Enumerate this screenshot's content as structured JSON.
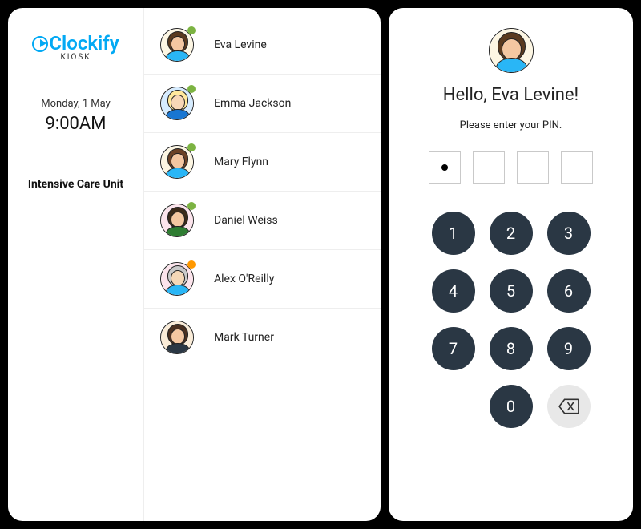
{
  "app": {
    "name": "Clockify",
    "subtitle": "KIOSK"
  },
  "sidebar": {
    "date": "Monday, 1 May",
    "time": "9:00AM",
    "unit": "Intensive Care Unit"
  },
  "employees": [
    {
      "name": "Eva Levine",
      "status": "green",
      "avatar": {
        "bg": "bg-cream",
        "hair": "#5b3a1e",
        "skin": "#f4c7a1",
        "shirt": "#29b6f6"
      }
    },
    {
      "name": "Emma Jackson",
      "status": "green",
      "avatar": {
        "bg": "bg-blue",
        "hair": "#ffe89c",
        "skin": "#f7d7b7",
        "shirt": "#1976d2"
      }
    },
    {
      "name": "Mary Flynn",
      "status": "green",
      "avatar": {
        "bg": "bg-cream",
        "hair": "#6b4226",
        "skin": "#f4c7a1",
        "shirt": "#29b6f6"
      }
    },
    {
      "name": "Daniel Weiss",
      "status": "green",
      "avatar": {
        "bg": "bg-pink",
        "hair": "#3b2a1a",
        "skin": "#f4c7a1",
        "shirt": "#2e7d32"
      }
    },
    {
      "name": "Alex O'Reilly",
      "status": "orange",
      "avatar": {
        "bg": "bg-pink",
        "hair": "#c9c9c9",
        "skin": "#f4d7b7",
        "shirt": "#29b6f6"
      }
    },
    {
      "name": "Mark Turner",
      "status": "none",
      "avatar": {
        "bg": "bg-tan",
        "hair": "#4a3020",
        "skin": "#f4c7a1",
        "shirt": "#2a3744"
      }
    }
  ],
  "pin_screen": {
    "greeting_prefix": "Hello, ",
    "greeting_name": "Eva Levine",
    "greeting_suffix": "!",
    "instruction": "Please enter your PIN.",
    "entered_digits": 1,
    "total_digits": 4,
    "selected_avatar": {
      "bg": "bg-cream",
      "hair": "#5b3a1e",
      "skin": "#f4c7a1",
      "shirt": "#29b6f6"
    }
  },
  "keypad": [
    "1",
    "2",
    "3",
    "4",
    "5",
    "6",
    "7",
    "8",
    "9",
    "0"
  ]
}
